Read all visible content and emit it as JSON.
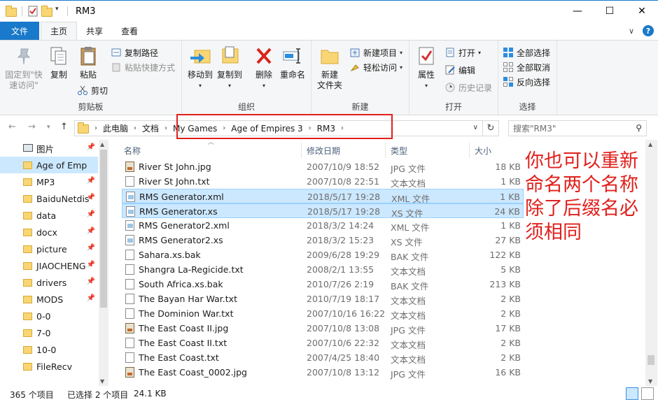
{
  "window": {
    "title": "RM3",
    "controls": [
      "—",
      "☐",
      "✕"
    ]
  },
  "ribbon_tabs": {
    "file": "文件",
    "tabs": [
      "主页",
      "共享",
      "查看"
    ],
    "active": "主页"
  },
  "ribbon": {
    "clipboard": {
      "label": "剪贴板",
      "pin": "固定到\"快速访问\"",
      "copy": "复制",
      "paste": "粘贴",
      "copy_path": "复制路径",
      "paste_shortcut": "粘贴快捷方式",
      "cut": "剪切"
    },
    "organize": {
      "label": "组织",
      "move_to": "移动到",
      "copy_to": "复制到",
      "delete": "删除",
      "rename": "重命名"
    },
    "new": {
      "label": "新建",
      "new_folder": "新建\n文件夹",
      "new_item": "新建项目",
      "easy_access": "轻松访问"
    },
    "open": {
      "label": "打开",
      "properties": "属性",
      "open": "打开",
      "edit": "编辑",
      "history": "历史记录"
    },
    "select": {
      "label": "选择",
      "select_all": "全部选择",
      "select_none": "全部取消",
      "invert": "反向选择"
    }
  },
  "address": {
    "crumbs": [
      "此电脑",
      "文档",
      "My Games",
      "Age of Empires 3",
      "RM3"
    ],
    "search_placeholder": "搜索\"RM3\""
  },
  "nav_pane": {
    "items": [
      {
        "label": "图片",
        "pinned": true,
        "selected": false
      },
      {
        "label": "Age of Emp",
        "pinned": false,
        "selected": true
      },
      {
        "label": "MP3",
        "pinned": true,
        "selected": false
      },
      {
        "label": "BaiduNetdis",
        "pinned": true,
        "selected": false
      },
      {
        "label": "data",
        "pinned": true,
        "selected": false
      },
      {
        "label": "docx",
        "pinned": true,
        "selected": false
      },
      {
        "label": "picture",
        "pinned": true,
        "selected": false
      },
      {
        "label": "JIAOCHENG",
        "pinned": true,
        "selected": false
      },
      {
        "label": "drivers",
        "pinned": true,
        "selected": false
      },
      {
        "label": "MODS",
        "pinned": true,
        "selected": false
      },
      {
        "label": "0-0",
        "pinned": false,
        "selected": false
      },
      {
        "label": "7-0",
        "pinned": false,
        "selected": false
      },
      {
        "label": "10-0",
        "pinned": false,
        "selected": false
      },
      {
        "label": "FileRecv",
        "pinned": false,
        "selected": false
      }
    ]
  },
  "columns": {
    "name": "名称",
    "date": "修改日期",
    "type": "类型",
    "size": "大小"
  },
  "files": [
    {
      "name": "River St John.jpg",
      "date": "2007/10/9 18:52",
      "type": "JPG 文件",
      "size": "18 KB",
      "icon": "img",
      "selected": false
    },
    {
      "name": "River St John.txt",
      "date": "2007/10/8 22:51",
      "type": "文本文档",
      "size": "1 KB",
      "icon": "txt",
      "selected": false
    },
    {
      "name": "RMS Generator.xml",
      "date": "2018/5/17 19:28",
      "type": "XML 文件",
      "size": "1 KB",
      "icon": "xml",
      "selected": true
    },
    {
      "name": "RMS Generator.xs",
      "date": "2018/5/17 19:28",
      "type": "XS 文件",
      "size": "24 KB",
      "icon": "xs",
      "selected": true
    },
    {
      "name": "RMS Generator2.xml",
      "date": "2018/3/2 14:24",
      "type": "XML 文件",
      "size": "1 KB",
      "icon": "xml",
      "selected": false
    },
    {
      "name": "RMS Generator2.xs",
      "date": "2018/3/2 15:23",
      "type": "XS 文件",
      "size": "27 KB",
      "icon": "xs",
      "selected": false
    },
    {
      "name": "Sahara.xs.bak",
      "date": "2009/6/28 19:29",
      "type": "BAK 文件",
      "size": "122 KB",
      "icon": "txt",
      "selected": false
    },
    {
      "name": "Shangra La-Regicide.txt",
      "date": "2008/2/1 13:55",
      "type": "文本文档",
      "size": "5 KB",
      "icon": "txt",
      "selected": false
    },
    {
      "name": "South Africa.xs.bak",
      "date": "2010/7/26 2:19",
      "type": "BAK 文件",
      "size": "213 KB",
      "icon": "txt",
      "selected": false
    },
    {
      "name": "The Bayan Har War.txt",
      "date": "2010/7/19 18:17",
      "type": "文本文档",
      "size": "2 KB",
      "icon": "txt",
      "selected": false
    },
    {
      "name": "The Dominion War.txt",
      "date": "2007/10/16 16:22",
      "type": "文本文档",
      "size": "2 KB",
      "icon": "txt",
      "selected": false
    },
    {
      "name": "The East Coast II.jpg",
      "date": "2007/10/8 13:08",
      "type": "JPG 文件",
      "size": "17 KB",
      "icon": "img",
      "selected": false
    },
    {
      "name": "The East Coast II.txt",
      "date": "2007/10/6 22:32",
      "type": "文本文档",
      "size": "2 KB",
      "icon": "txt",
      "selected": false
    },
    {
      "name": "The East Coast.txt",
      "date": "2007/4/25 18:40",
      "type": "文本文档",
      "size": "2 KB",
      "icon": "txt",
      "selected": false
    },
    {
      "name": "The East Coast_0002.jpg",
      "date": "2007/10/8 13:12",
      "type": "JPG 文件",
      "size": "16 KB",
      "icon": "img",
      "selected": false
    }
  ],
  "annotation": "你也可以重新命名两个名称除了后缀名必须相同",
  "status": {
    "count": "365 个项目",
    "selected": "已选择 2 个项目",
    "size": "24.1 KB"
  },
  "colors": {
    "accent": "#1979ca",
    "selection": "#cce8ff",
    "annotation": "#e0201c"
  }
}
